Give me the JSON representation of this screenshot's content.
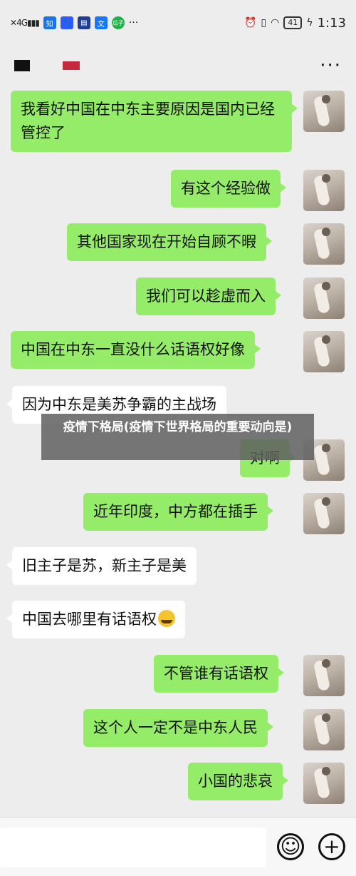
{
  "status_bar": {
    "left_icons": [
      "signal-icon",
      "app-icon-zhi",
      "baidu-icon",
      "news-icon",
      "alipay-icon",
      "watermelon-icon",
      "more-dots-icon"
    ],
    "signal_text": "4G",
    "app_zhi": "知",
    "app_wen": "文",
    "app_gua": "瓜子",
    "dots": "···",
    "battery": "41",
    "time": "1:13"
  },
  "nav": {
    "more": "···"
  },
  "messages": [
    {
      "side": "right",
      "text": "我看好中国在中东主要原因是国内已经管控了"
    },
    {
      "side": "right",
      "text": "有这个经验做"
    },
    {
      "side": "right",
      "text": "其他国家现在开始自顾不暇"
    },
    {
      "side": "right",
      "text": "我们可以趁虚而入"
    },
    {
      "side": "right",
      "text": "中国在中东一直没什么话语权好像"
    },
    {
      "side": "left",
      "text": "因为中东是美苏争霸的主战场"
    },
    {
      "side": "right",
      "text": "对啊"
    },
    {
      "side": "right",
      "text": "近年印度，中方都在插手"
    },
    {
      "side": "left",
      "text": "旧主子是苏，新主子是美"
    },
    {
      "side": "left",
      "text": "中国去哪里有话语权",
      "emoji": "laughing-crying-emoji"
    },
    {
      "side": "right",
      "text": "不管谁有话语权"
    },
    {
      "side": "right",
      "text": "这个人一定不是中东人民"
    },
    {
      "side": "right",
      "text": "小国的悲哀"
    }
  ],
  "overlay": {
    "title": "疫情下格局(疫情下世界格局的重要动向是)"
  },
  "input_bar": {
    "emoji_icon": "smiley-icon",
    "plus_icon": "plus-icon",
    "plus": "+",
    "smile": "☺"
  },
  "colors": {
    "right_bubble": "#95ec69",
    "left_bubble": "#ffffff",
    "background": "#ededed"
  }
}
